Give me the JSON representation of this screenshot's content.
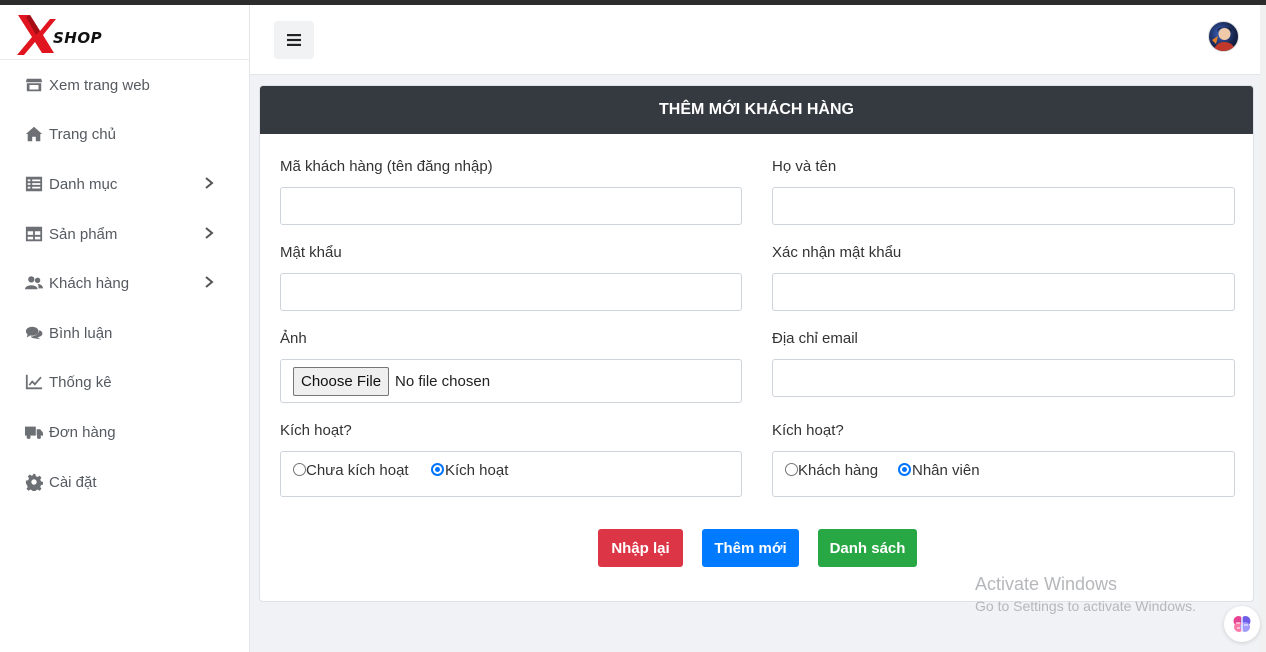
{
  "brand": {
    "logo_text": "SHOP"
  },
  "sidebar": {
    "items": [
      {
        "label": "Xem trang web",
        "icon": "store-icon",
        "has_submenu": false
      },
      {
        "label": "Trang chủ",
        "icon": "home-icon",
        "has_submenu": false
      },
      {
        "label": "Danh mục",
        "icon": "list-icon",
        "has_submenu": true
      },
      {
        "label": "Sản phẩm",
        "icon": "table-icon",
        "has_submenu": true
      },
      {
        "label": "Khách hàng",
        "icon": "users-icon",
        "has_submenu": true
      },
      {
        "label": "Bình luận",
        "icon": "comments-icon",
        "has_submenu": false
      },
      {
        "label": "Thống kê",
        "icon": "chart-line-icon",
        "has_submenu": false
      },
      {
        "label": "Đơn hàng",
        "icon": "truck-icon",
        "has_submenu": false
      },
      {
        "label": "Cài đặt",
        "icon": "gear-icon",
        "has_submenu": false
      }
    ]
  },
  "topbar": {
    "menu_icon": "hamburger-icon",
    "avatar_icon": "user-avatar"
  },
  "form": {
    "title": "THÊM MỚI KHÁCH HÀNG",
    "fields": {
      "customer_id": {
        "label": "Mã khách hàng (tên đăng nhập)",
        "value": ""
      },
      "full_name": {
        "label": "Họ và tên",
        "value": ""
      },
      "password": {
        "label": "Mật khẩu",
        "value": ""
      },
      "confirm_password": {
        "label": "Xác nhận mật khẩu",
        "value": ""
      },
      "photo": {
        "label": "Ảnh",
        "button": "Choose File",
        "status": "No file chosen"
      },
      "email": {
        "label": "Địa chỉ email",
        "value": ""
      },
      "activation": {
        "label": "Kích hoạt?",
        "options": [
          "Chưa kích hoạt",
          "Kích hoạt"
        ],
        "selected": "Kích hoạt"
      },
      "role": {
        "label": "Kích hoạt?",
        "options": [
          "Khách hàng",
          "Nhân viên"
        ],
        "selected": "Nhân viên"
      }
    },
    "buttons": {
      "reset": "Nhập lại",
      "add": "Thêm mới",
      "list": "Danh sách"
    }
  },
  "watermark": {
    "title": "Activate Windows",
    "subtitle": "Go to Settings to activate Windows."
  },
  "colors": {
    "header": "#343a40",
    "reset": "#dc3545",
    "add": "#007bff",
    "list": "#28a745",
    "radio": "#0075ff"
  }
}
